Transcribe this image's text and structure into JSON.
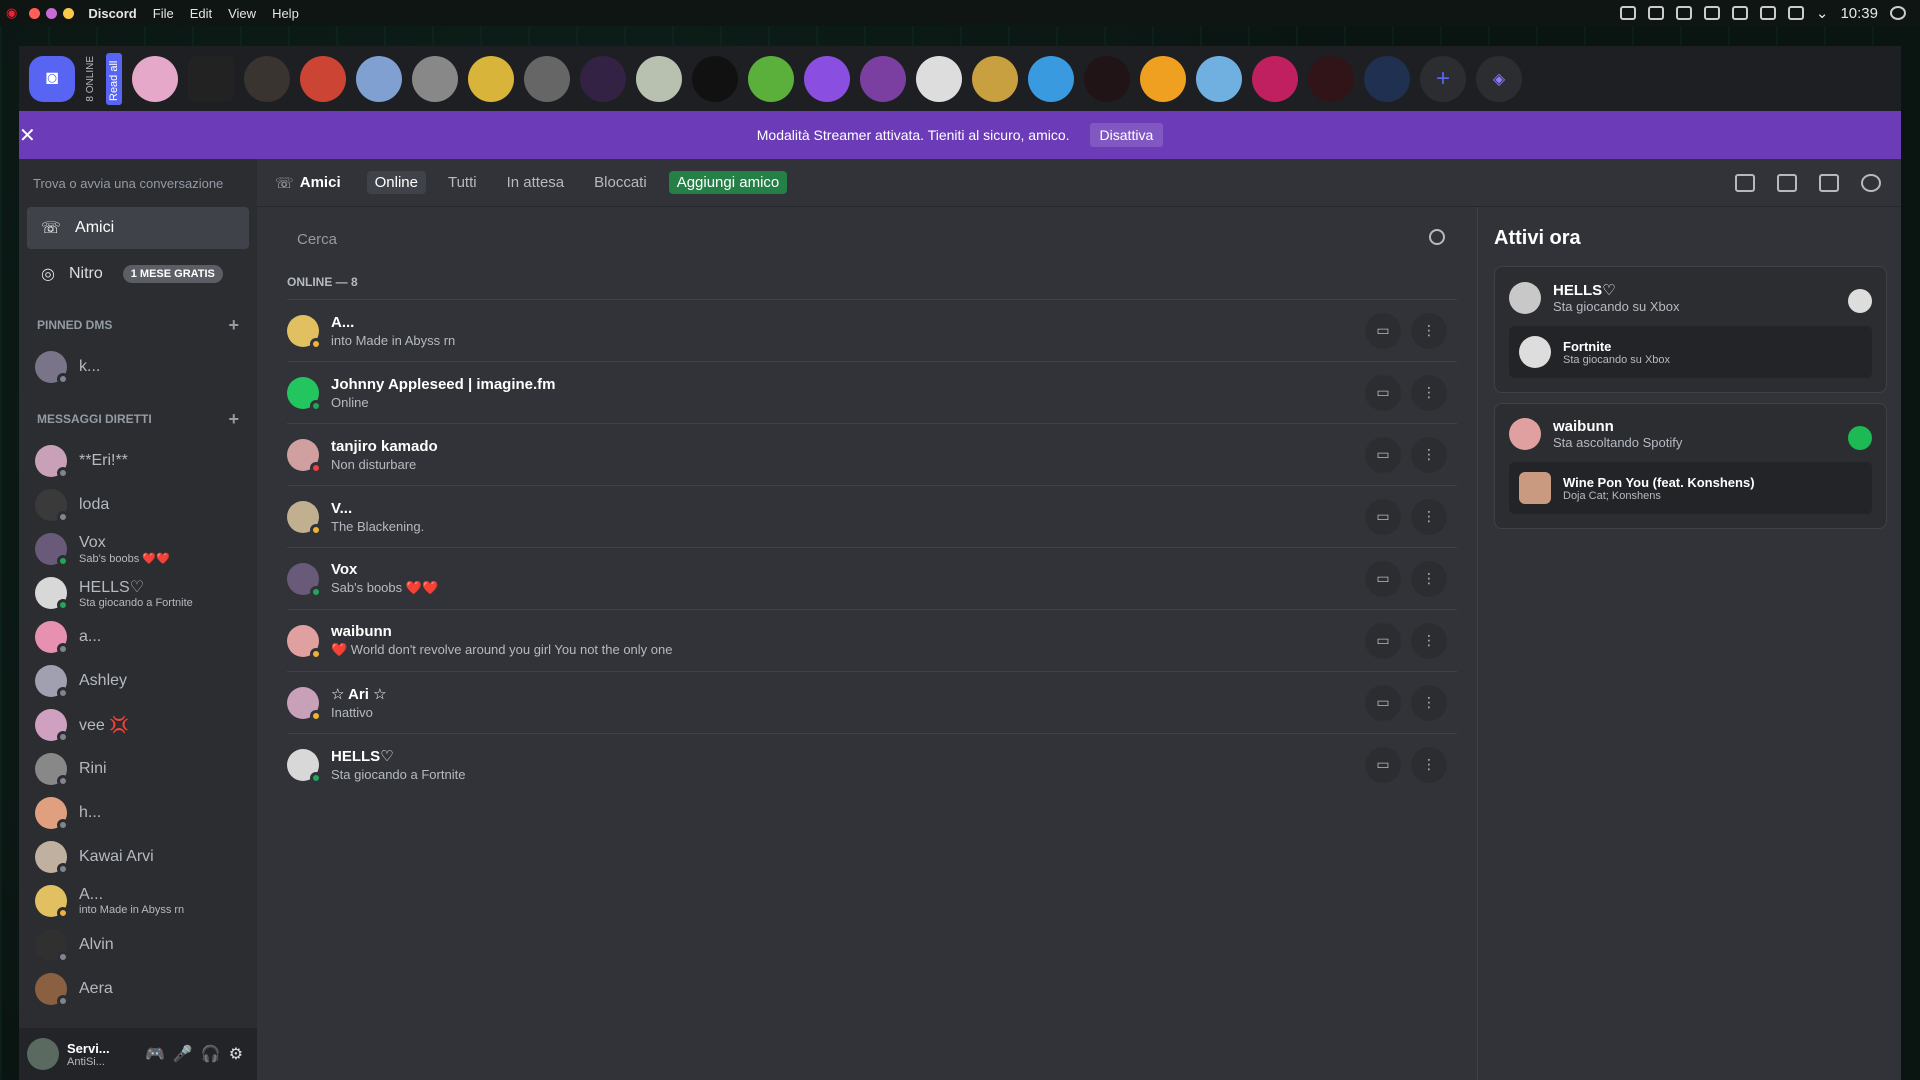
{
  "menubar": {
    "app": "Discord",
    "menus": [
      "File",
      "Edit",
      "View",
      "Help"
    ],
    "time": "10:39"
  },
  "servers": {
    "online_count": "8 ONLINE",
    "read_all": "Read all"
  },
  "banner": {
    "text": "Modalità Streamer attivata. Tieniti al sicuro, amico.",
    "button": "Disattiva"
  },
  "sidebar": {
    "search_placeholder": "Trova o avvia una conversazione",
    "nav": [
      {
        "label": "Amici"
      },
      {
        "label": "Nitro",
        "badge": "1 MESE GRATIS"
      }
    ],
    "pinned_header": "PINNED DMS",
    "pinned": [
      {
        "name": "k..."
      }
    ],
    "dm_header": "MESSAGGI DIRETTI",
    "dms": [
      {
        "name": "**Eri!**",
        "sub": ""
      },
      {
        "name": "loda",
        "sub": ""
      },
      {
        "name": "Vox",
        "sub": "Sab's boobs ❤️❤️"
      },
      {
        "name": "HELLS♡",
        "sub": "Sta giocando a Fortnite"
      },
      {
        "name": "a...",
        "sub": ""
      },
      {
        "name": "Ashley",
        "sub": ""
      },
      {
        "name": "vee 💢",
        "sub": ""
      },
      {
        "name": "Rini",
        "sub": ""
      },
      {
        "name": "h...",
        "sub": ""
      },
      {
        "name": "Kawai Arvi",
        "sub": ""
      },
      {
        "name": "A...",
        "sub": "into Made in Abyss rn"
      },
      {
        "name": "Alvin",
        "sub": ""
      },
      {
        "name": "Aera",
        "sub": ""
      }
    ],
    "user": {
      "name": "Servi...",
      "sub": "AntiSi..."
    }
  },
  "topbar": {
    "title": "Amici",
    "tabs": [
      "Online",
      "Tutti",
      "In attesa",
      "Bloccati"
    ],
    "add_friend": "Aggiungi amico"
  },
  "friends": {
    "search_placeholder": "Cerca",
    "header": "ONLINE — 8",
    "list": [
      {
        "name": "A...",
        "status": "into Made in Abyss rn"
      },
      {
        "name": "Johnny Appleseed | imagine.fm",
        "status": "Online"
      },
      {
        "name": "tanjiro kamado",
        "status": "Non disturbare"
      },
      {
        "name": "V...",
        "status": "The Blackening."
      },
      {
        "name": "Vox",
        "status": "Sab's boobs ❤️❤️"
      },
      {
        "name": "waibunn",
        "status": "❤️ World don't revolve around you girl You not the only one"
      },
      {
        "name": "☆ Ari ☆",
        "status": "Inattivo"
      },
      {
        "name": "HELLS♡",
        "status": "Sta giocando a Fortnite"
      }
    ]
  },
  "active_now": {
    "title": "Attivi ora",
    "cards": [
      {
        "name": "HELLS♡",
        "status": "Sta giocando su Xbox",
        "game": "Fortnite",
        "game_sub": "Sta giocando su Xbox"
      },
      {
        "name": "waibunn",
        "status": "Sta ascoltando Spotify",
        "game": "Wine Pon You (feat. Konshens)",
        "game_sub": "Doja Cat; Konshens"
      }
    ]
  },
  "colors": {
    "accent": "#5865f2",
    "banner": "#6c3bb8",
    "online": "#23a55a",
    "idle": "#f0b232",
    "dnd": "#f23f43",
    "add": "#248046"
  }
}
